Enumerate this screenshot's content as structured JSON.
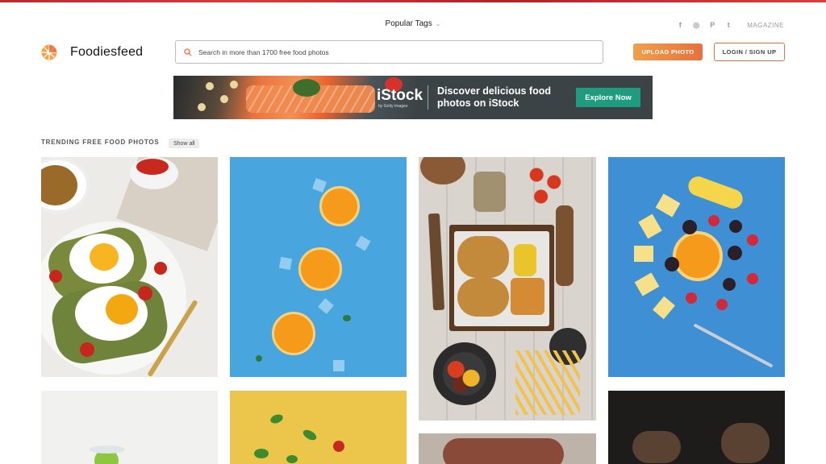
{
  "header": {
    "popular_tags": "Popular Tags",
    "magazine": "MAGAZINE",
    "socials": [
      {
        "icon": "facebook-icon",
        "glyph": "f"
      },
      {
        "icon": "instagram-icon",
        "glyph": "◎"
      },
      {
        "icon": "pinterest-icon",
        "glyph": "P"
      },
      {
        "icon": "twitter-icon",
        "glyph": "t"
      }
    ]
  },
  "brand": {
    "name": "Foodiesfeed",
    "accent": "#e8703d"
  },
  "search": {
    "placeholder": "Search in more than 1700 free food photos",
    "value": ""
  },
  "buttons": {
    "upload": "UPLOAD PHOTO",
    "login": "LOGIN / SIGN UP"
  },
  "banner": {
    "logo": "iStock",
    "sublogo": "by Getty Images",
    "headline": "Discover delicious food photos on iStock",
    "cta": "Explore Now",
    "cta_color": "#1f9c7d"
  },
  "trending": {
    "title": "TRENDING FREE FOOD PHOTOS",
    "show_all": "Show all",
    "photos": [
      "avocado-toast-with-fried-eggs",
      "orange-slices-on-blue-background",
      "burgers-and-fries-on-wooden-table",
      "fruit-spiral-on-blue-background",
      "lime-splash-on-white",
      "falling-vegetables-on-yellow",
      "grilled-steak",
      "hands-in-dark-kitchen"
    ]
  }
}
